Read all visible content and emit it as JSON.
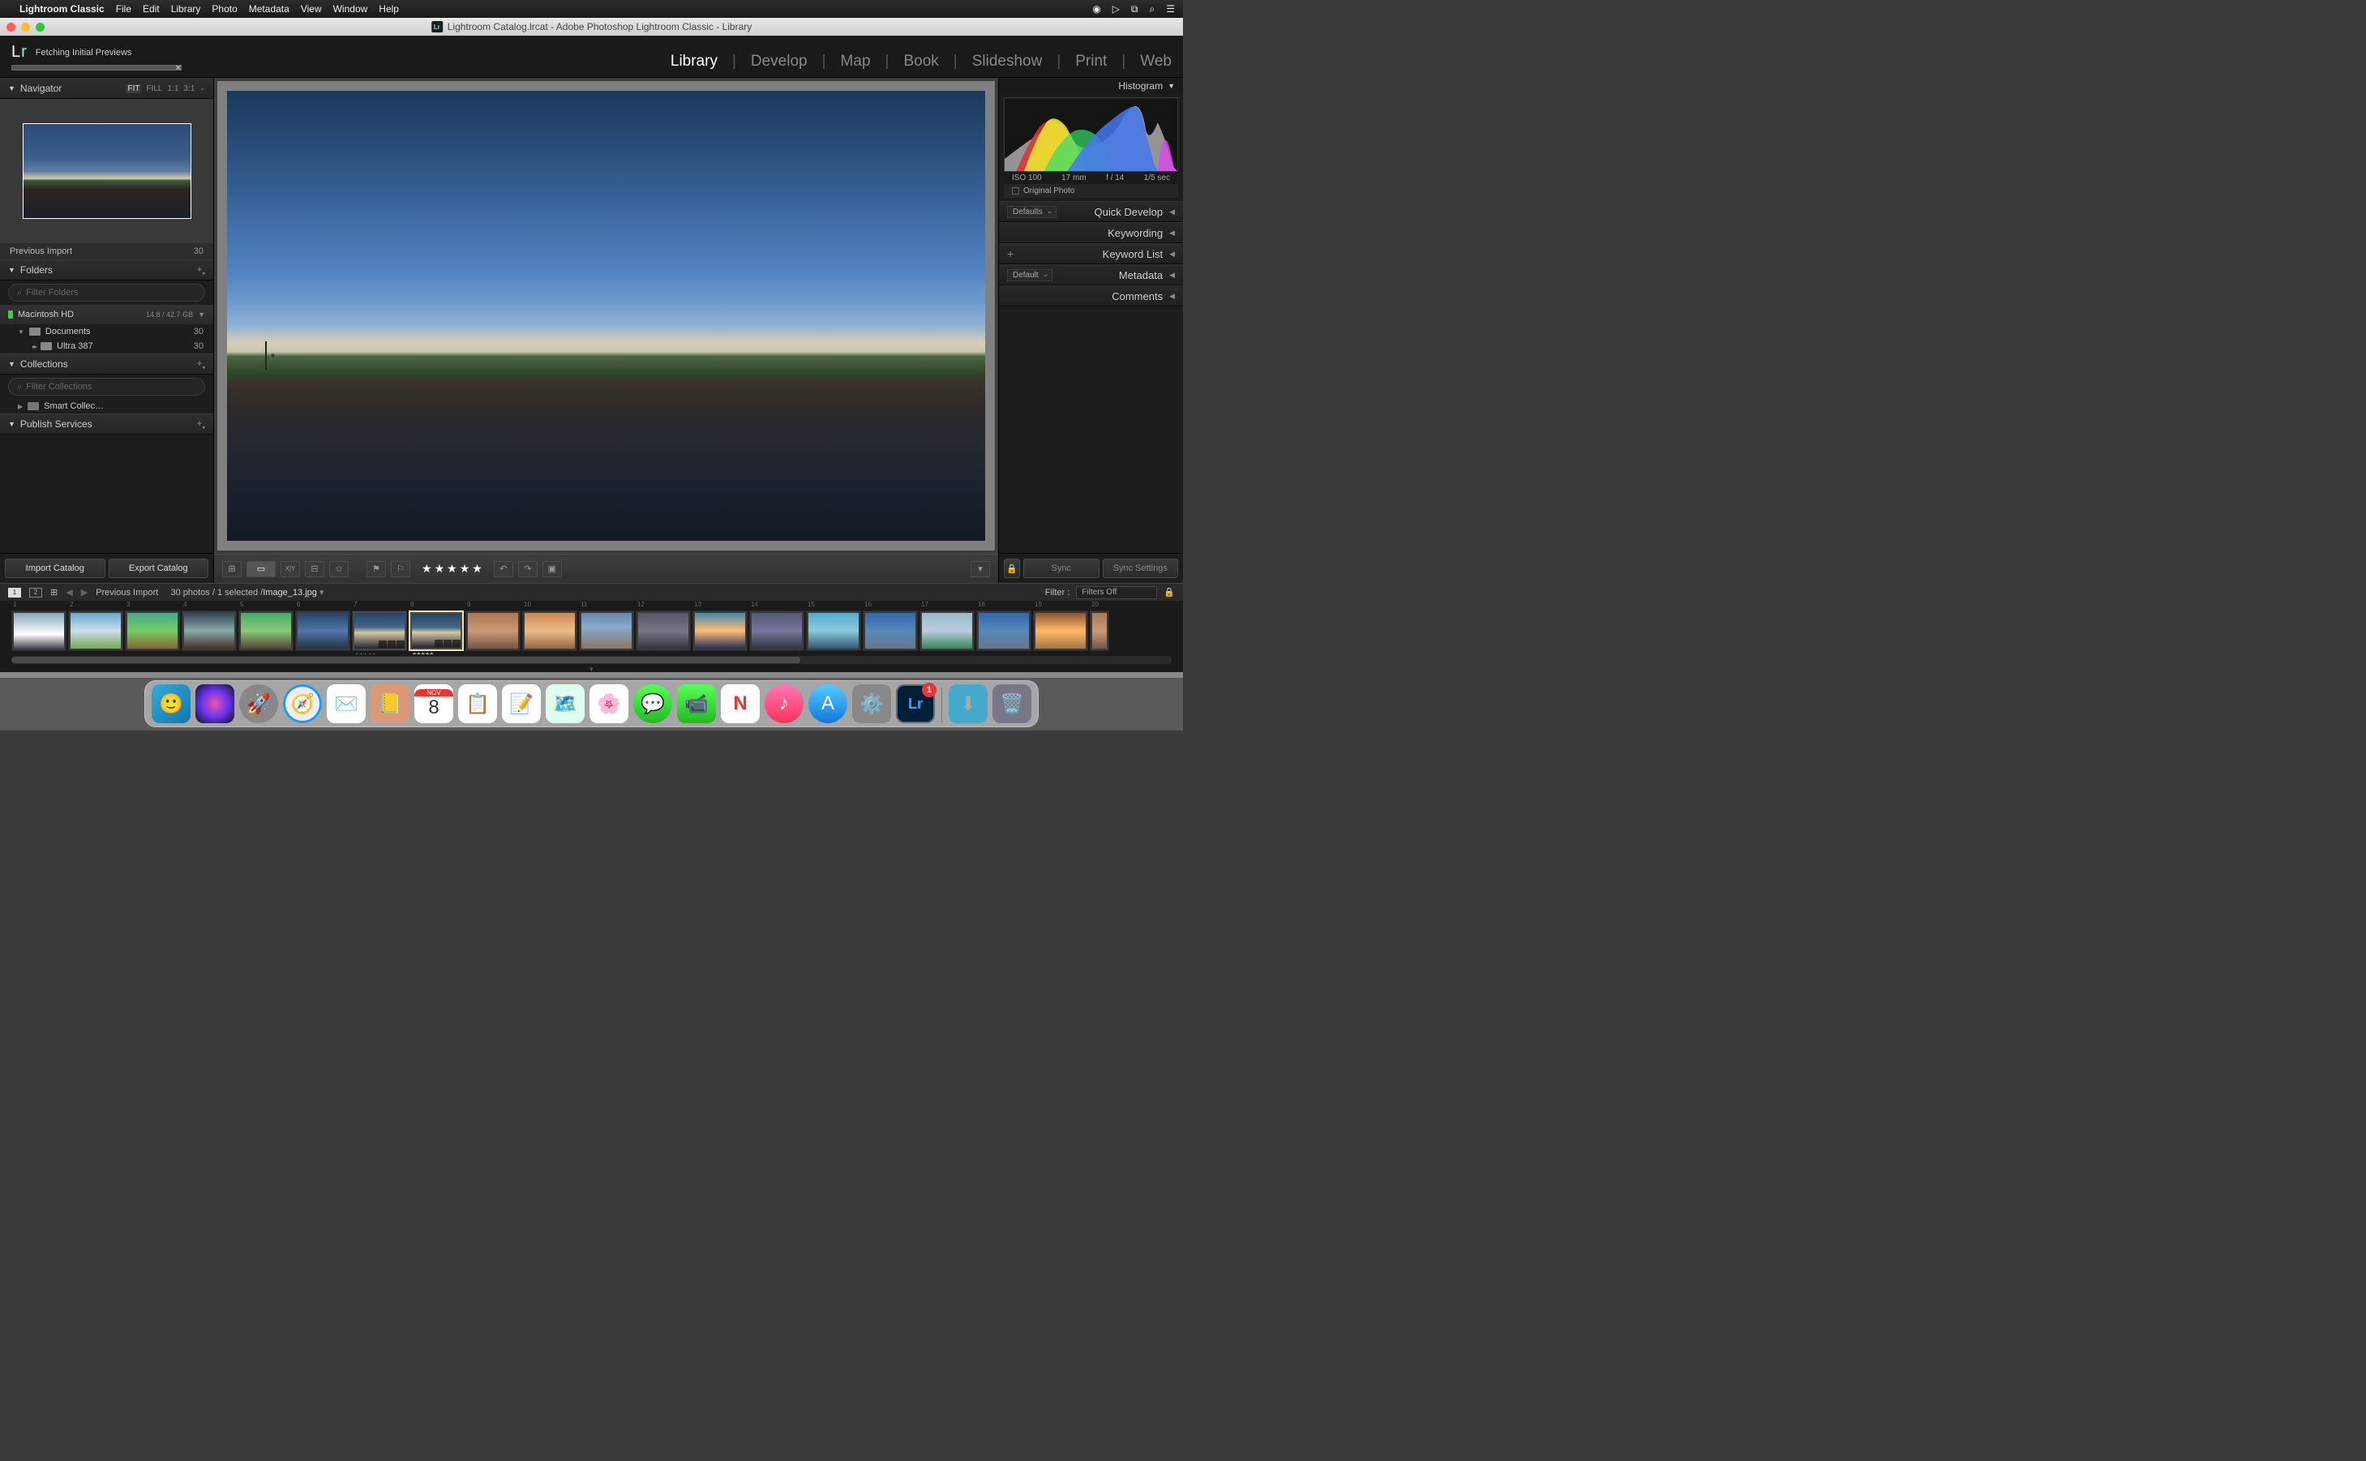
{
  "menubar": {
    "app": "Lightroom Classic",
    "items": [
      "File",
      "Edit",
      "Library",
      "Photo",
      "Metadata",
      "View",
      "Window",
      "Help"
    ]
  },
  "window_title": "Lightroom Catalog.lrcat - Adobe Photoshop Lightroom Classic - Library",
  "topbar": {
    "logo": "Lr",
    "status": "Fetching Initial Previews"
  },
  "modules": {
    "items": [
      "Library",
      "Develop",
      "Map",
      "Book",
      "Slideshow",
      "Print",
      "Web"
    ],
    "active": "Library"
  },
  "navigator": {
    "title": "Navigator",
    "opts": [
      "FIT",
      "FILL",
      "1:1",
      "3:1"
    ],
    "active": "FIT"
  },
  "prev_import": {
    "label": "Previous Import",
    "count": "30"
  },
  "folders": {
    "title": "Folders",
    "filter_placeholder": "Filter Folders",
    "disk": {
      "name": "Macintosh HD",
      "size": "14.8 / 42.7 GB"
    },
    "tree": [
      {
        "name": "Documents",
        "count": "30"
      },
      {
        "name": "Ultra 387",
        "count": "30"
      }
    ]
  },
  "collections": {
    "title": "Collections",
    "filter_placeholder": "Filter Collections",
    "smart": "Smart Collec…"
  },
  "publish": {
    "title": "Publish Services"
  },
  "buttons": {
    "import": "Import Catalog",
    "export": "Export Catalog"
  },
  "histogram": {
    "title": "Histogram",
    "iso": "ISO 100",
    "focal": "17 mm",
    "aperture": "f / 14",
    "shutter": "1/5 sec",
    "original": "Original Photo"
  },
  "right_panels": {
    "quick_develop": "Quick Develop",
    "defaults": "Defaults",
    "keywording": "Keywording",
    "keyword_list": "Keyword List",
    "metadata": "Metadata",
    "metadata_preset": "Default",
    "comments": "Comments"
  },
  "sync": {
    "sync": "Sync",
    "settings": "Sync Settings"
  },
  "filmstrip_header": {
    "monitors": [
      "1",
      "2"
    ],
    "source": "Previous Import",
    "count_sel": "30 photos / 1 selected /",
    "filename": "Image_13.jpg",
    "filter_label": "Filter :",
    "filter_value": "Filters Off"
  },
  "calendar": {
    "month": "NOV",
    "day": "8"
  },
  "dock_badge": "1",
  "lr_icon_label": "Lr"
}
